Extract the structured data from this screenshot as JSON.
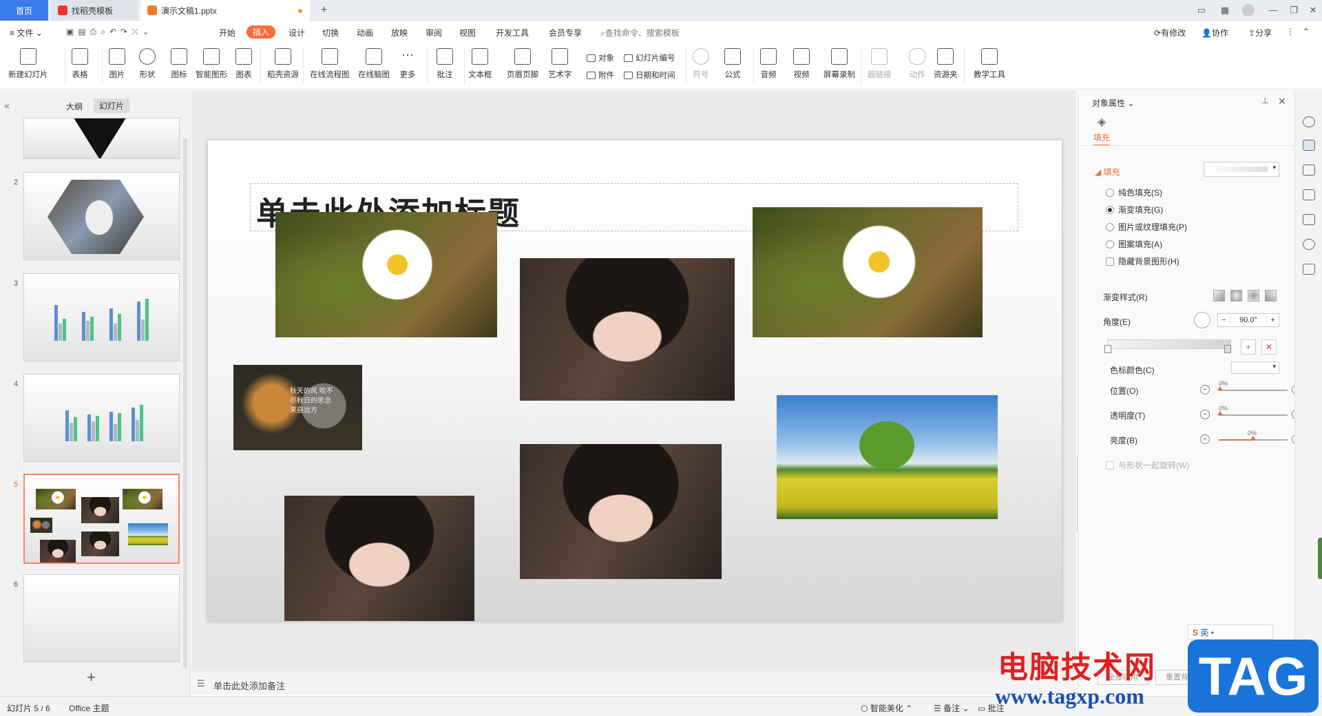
{
  "tabs": {
    "home": "首页",
    "template": "找稻壳模板",
    "doc": "演示文稿1.pptx",
    "add": "+"
  },
  "menu": {
    "file": "文件",
    "items": [
      "开始",
      "插入",
      "设计",
      "切换",
      "动画",
      "放映",
      "审阅",
      "视图",
      "开发工具",
      "会员专享"
    ],
    "active": "插入",
    "search": "查找命令、搜索模板",
    "modify": "有修改",
    "collab": "协作",
    "share": "分享"
  },
  "ribbon": {
    "big": [
      "新建幻灯片",
      "表格",
      "图片",
      "形状",
      "图标",
      "智能图形",
      "图表",
      "稻壳资源",
      "在线流程图",
      "在线脑图",
      "更多",
      "批注",
      "文本框",
      "页眉页脚",
      "艺术字"
    ],
    "small": {
      "object": "对象",
      "attach": "附件",
      "slide_num": "幻灯片编号",
      "datetime": "日期和时间"
    },
    "big2": [
      "符号",
      "公式",
      "音频",
      "视频",
      "屏幕录制",
      "超链接",
      "动作",
      "资源夹",
      "教学工具"
    ]
  },
  "leftpanel": {
    "outline": "大纲",
    "slides": "幻灯片",
    "add": "+",
    "thumbs": [
      "2",
      "3",
      "4",
      "5",
      "6"
    ]
  },
  "slide": {
    "title": "单击此处添加标题",
    "leaf_text": "秋天的风 吹不尽秋日的思念 来自远方"
  },
  "notes": "单击此处添加备注",
  "rightpanel": {
    "header": "对象属性",
    "tab": "填充",
    "section": "填充",
    "options": [
      "纯色填充(S)",
      "渐变填充(G)",
      "图片或纹理填充(P)",
      "图案填充(A)"
    ],
    "hide_bg": "隐藏背景图形(H)",
    "gradient_style": "渐变样式(R)",
    "angle_label": "角度(E)",
    "angle_value": "90.0°",
    "color_label": "色标颜色(C)",
    "pos_label": "位置(O)",
    "pos_value": "0%",
    "trans_label": "透明度(T)",
    "trans_value": "0%",
    "bright_label": "亮度(B)",
    "bright_value": "0%",
    "rotate": "与形状一起旋转(W)",
    "apply_all": "全部应用",
    "reset_bg": "重置背景"
  },
  "status": {
    "slide": "幻灯片 5 / 6",
    "theme": "Office 主题",
    "beautify": "智能美化",
    "notes": "备注",
    "comments": "批注"
  },
  "watermark": {
    "site": "电脑技术网",
    "url": "www.tagxp.com",
    "tag": "TAG",
    "ime": "英"
  }
}
